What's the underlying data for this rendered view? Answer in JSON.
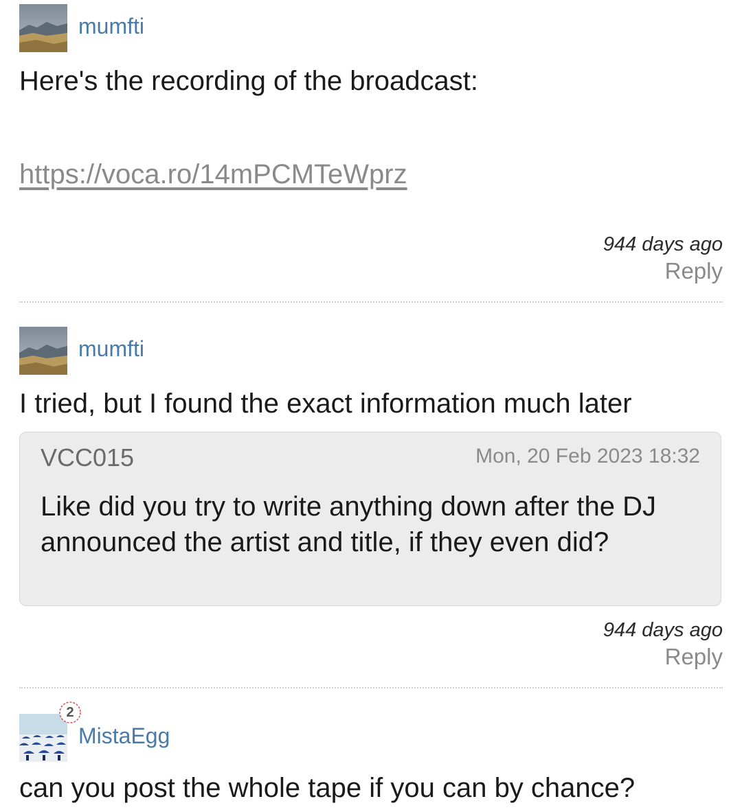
{
  "comments": [
    {
      "username": "mumfti",
      "avatar_icon": "landscape-avatar",
      "text": "Here's the recording of the broadcast:",
      "link": "https://voca.ro/14mPCMTeWprz",
      "time": "944 days ago",
      "reply": "Reply"
    },
    {
      "username": "mumfti",
      "avatar_icon": "landscape-avatar",
      "text": "I tried, but I found the exact information much later",
      "quote": {
        "author": "VCC015",
        "date": "Mon, 20 Feb 2023 18:32",
        "text": "Like did you try to write anything down after the DJ announced the artist and title, if they even did?"
      },
      "time": "944 days ago",
      "reply": "Reply"
    },
    {
      "username": "MistaEgg",
      "avatar_icon": "umbrella-beach-avatar",
      "badge": "2",
      "text": "can you post the whole tape if you can by chance?"
    }
  ],
  "colors": {
    "username": "#4a7aa8",
    "muted": "#8a8a8a",
    "quote_bg": "#ececec"
  }
}
